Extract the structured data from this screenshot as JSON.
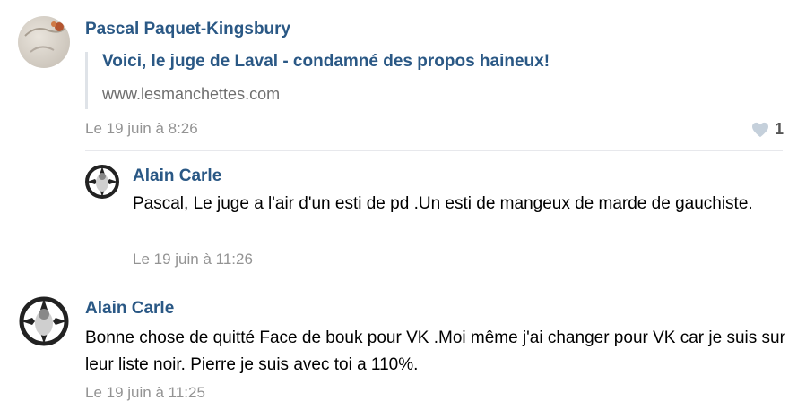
{
  "comments": [
    {
      "author": "Pascal Paquet-Kingsbury",
      "link_title": "Voici, le juge de Laval - condamné des propos haineux!",
      "link_domain": "www.lesmanchettes.com",
      "date": "Le 19 juin à 8:26",
      "likes": "1",
      "avatar_icon": "profile-photo"
    },
    {
      "author": "Alain Carle",
      "text": "Pascal, Le juge a l'air d'un esti de pd .Un esti de mangeux de marde de gauchiste.",
      "date": "Le 19 juin à 11:26",
      "avatar_icon": "emblem-avatar"
    },
    {
      "author": "Alain Carle",
      "text": "Bonne chose de quitté Face de bouk pour VK .Moi même j'ai changer pour VK car je suis sur leur liste noir. Pierre je suis avec toi a 110%.",
      "date": "Le 19 juin à 11:25",
      "avatar_icon": "emblem-avatar"
    }
  ],
  "colors": {
    "link": "#2a5885",
    "date": "#939393",
    "divider": "#e7e8ec",
    "heart": "#c5d0db"
  }
}
